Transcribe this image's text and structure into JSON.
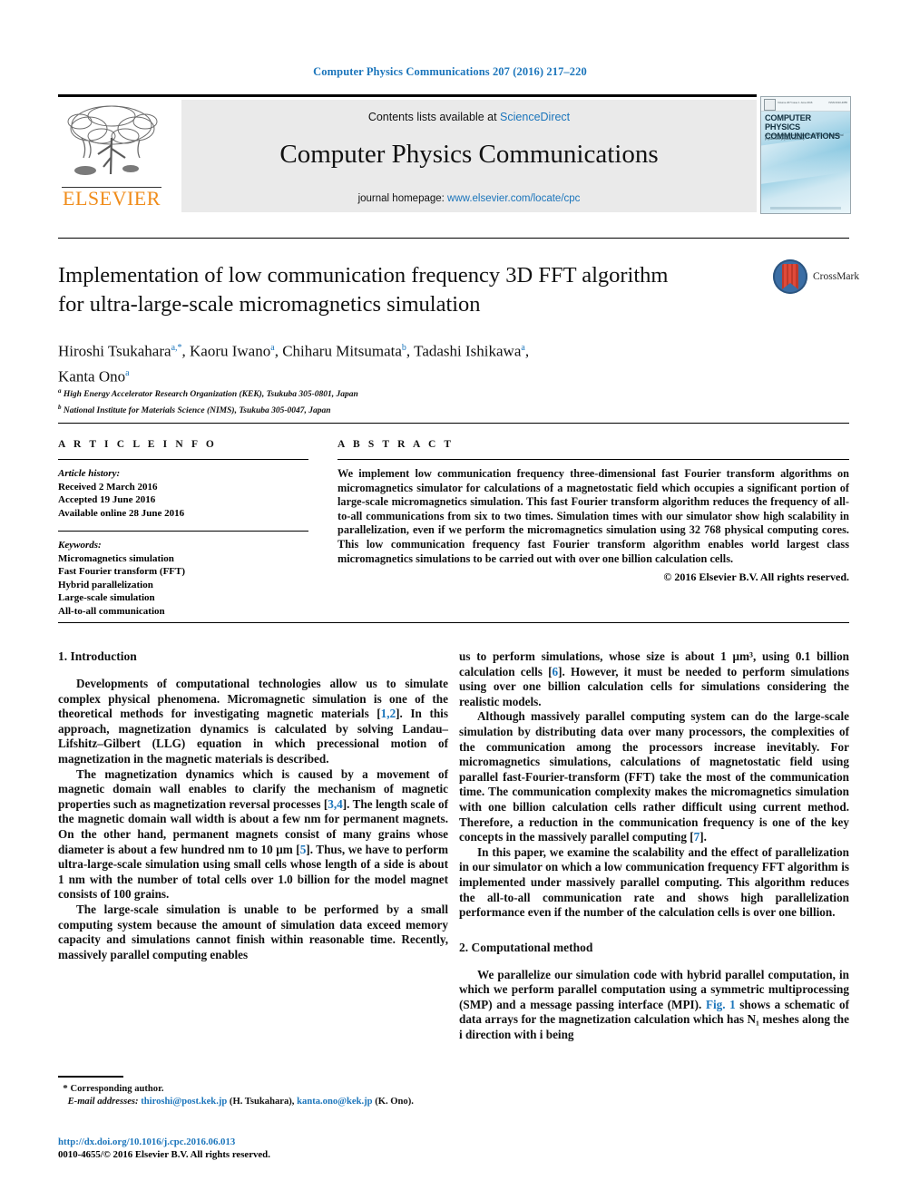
{
  "running_head": "Computer Physics Communications 207 (2016) 217–220",
  "masthead": {
    "contents_prefix": "Contents lists available at ",
    "sciencedirect": "ScienceDirect",
    "journal_title": "Computer Physics Communications",
    "homepage_prefix": "journal homepage: ",
    "homepage_url": "www.elsevier.com/locate/cpc",
    "publisher_logo_text": "ELSEVIER",
    "cover": {
      "title_line1": "COMPUTER PHYSICS",
      "title_line2": "COMMUNICATIONS",
      "subtitle": "An international journal and program library for computational physics and physical chemistry",
      "top_left_meta": "Volume 207 Issue 1 June 2016",
      "top_right_meta": "ISSN 0010-4655"
    }
  },
  "article": {
    "title_line1": "Implementation of low communication frequency 3D FFT algorithm",
    "title_line2": "for ultra-large-scale micromagnetics simulation",
    "crossmark_label": "CrossMark",
    "authors": [
      {
        "name": "Hiroshi Tsukahara",
        "marks": "a,*"
      },
      {
        "name": "Kaoru Iwano",
        "marks": "a"
      },
      {
        "name": "Chiharu Mitsumata",
        "marks": "b"
      },
      {
        "name": "Tadashi Ishikawa",
        "marks": "a"
      },
      {
        "name": "Kanta Ono",
        "marks": "a"
      }
    ],
    "affiliations": [
      {
        "mark": "a",
        "text": "High Energy Accelerator Research Organization (KEK), Tsukuba 305-0801, Japan"
      },
      {
        "mark": "b",
        "text": "National Institute for Materials Science (NIMS), Tsukuba 305-0047, Japan"
      }
    ]
  },
  "article_info": {
    "heading": "A R T I C L E   I N F O",
    "history_label": "Article history:",
    "history": [
      "Received 2 March 2016",
      "Accepted 19 June 2016",
      "Available online 28 June 2016"
    ],
    "keywords_label": "Keywords:",
    "keywords": [
      "Micromagnetics simulation",
      "Fast Fourier transform (FFT)",
      "Hybrid parallelization",
      "Large-scale simulation",
      "All-to-all communication"
    ]
  },
  "abstract": {
    "heading": "A B S T R A C T",
    "text": "We implement low communication frequency three-dimensional fast Fourier transform algorithms on micromagnetics simulator for calculations of a magnetostatic field which occupies a significant portion of large-scale micromagnetics simulation. This fast Fourier transform algorithm reduces the frequency of all-to-all communications from six to two times. Simulation times with our simulator show high scalability in parallelization, even if we perform the micromagnetics simulation using 32 768 physical computing cores. This low communication frequency fast Fourier transform algorithm enables world largest class micromagnetics simulations to be carried out with over one billion calculation cells.",
    "copyright": "© 2016 Elsevier B.V. All rights reserved."
  },
  "body": {
    "section1_heading": "1. Introduction",
    "section2_heading": "2. Computational method",
    "left_paragraphs": [
      "Developments of computational technologies allow us to simulate complex physical phenomena. Micromagnetic simulation is one of the theoretical methods for investigating magnetic materials [1,2]. In this approach, magnetization dynamics is calculated by solving Landau–Lifshitz–Gilbert (LLG) equation in which precessional motion of magnetization in the magnetic materials is described.",
      "The magnetization dynamics which is caused by a movement of magnetic domain wall enables to clarify the mechanism of magnetic properties such as magnetization reversal processes [3,4]. The length scale of the magnetic domain wall width is about a few nm for permanent magnets. On the other hand, permanent magnets consist of many grains whose diameter is about a few hundred nm to 10 μm [5]. Thus, we have to perform ultra-large-scale simulation using small cells whose length of a side is about 1 nm with the number of total cells over 1.0 billion for the model magnet consists of 100 grains.",
      "The large-scale simulation is unable to be performed by a small computing system because the amount of simulation data exceed memory capacity and simulations cannot finish within reasonable time. Recently, massively parallel computing enables"
    ],
    "right_paragraphs": [
      "us to perform simulations, whose size is about 1 μm³, using 0.1 billion calculation cells [6]. However, it must be needed to perform simulations using over one billion calculation cells for simulations considering the realistic models.",
      "Although massively parallel computing system can do the large-scale simulation by distributing data over many processors, the complexities of the communication among the processors increase inevitably. For micromagnetics simulations, calculations of magnetostatic field using parallel fast-Fourier-transform (FFT) take the most of the communication time. The communication complexity makes the micromagnetics simulation with one billion calculation cells rather difficult using current method. Therefore, a reduction in the communication frequency is one of the key concepts in the massively parallel computing [7].",
      "In this paper, we examine the scalability and the effect of parallelization in our simulator on which a low communication frequency FFT algorithm is implemented under massively parallel computing. This algorithm reduces the all-to-all communication rate and shows high parallelization performance even if the number of the calculation cells is over one billion."
    ],
    "section2_paragraph": "We parallelize our simulation code with hybrid parallel computation, in which we perform parallel computation using a symmetric multiprocessing (SMP) and a message passing interface (MPI). Fig. 1 shows a schematic of data arrays for the magnetization calculation which has N₁ meshes along the i direction with i being"
  },
  "footnote": {
    "corresponding_marker": "*",
    "corresponding_text": "Corresponding author.",
    "email_label": "E-mail addresses:",
    "email1": "thiroshi@post.kek.jp",
    "email1_owner": "(H. Tsukahara),",
    "email2": "kanta.ono@kek.jp",
    "email2_owner": "(K. Ono)."
  },
  "doi_block": {
    "doi_url": "http://dx.doi.org/10.1016/j.cpc.2016.06.013",
    "issn_line": "0010-4655/© 2016 Elsevier B.V. All rights reserved."
  },
  "colors": {
    "link_blue": "#1b75bb",
    "elsevier_orange": "#f08c1a",
    "panel_gray": "#eaeaea"
  }
}
